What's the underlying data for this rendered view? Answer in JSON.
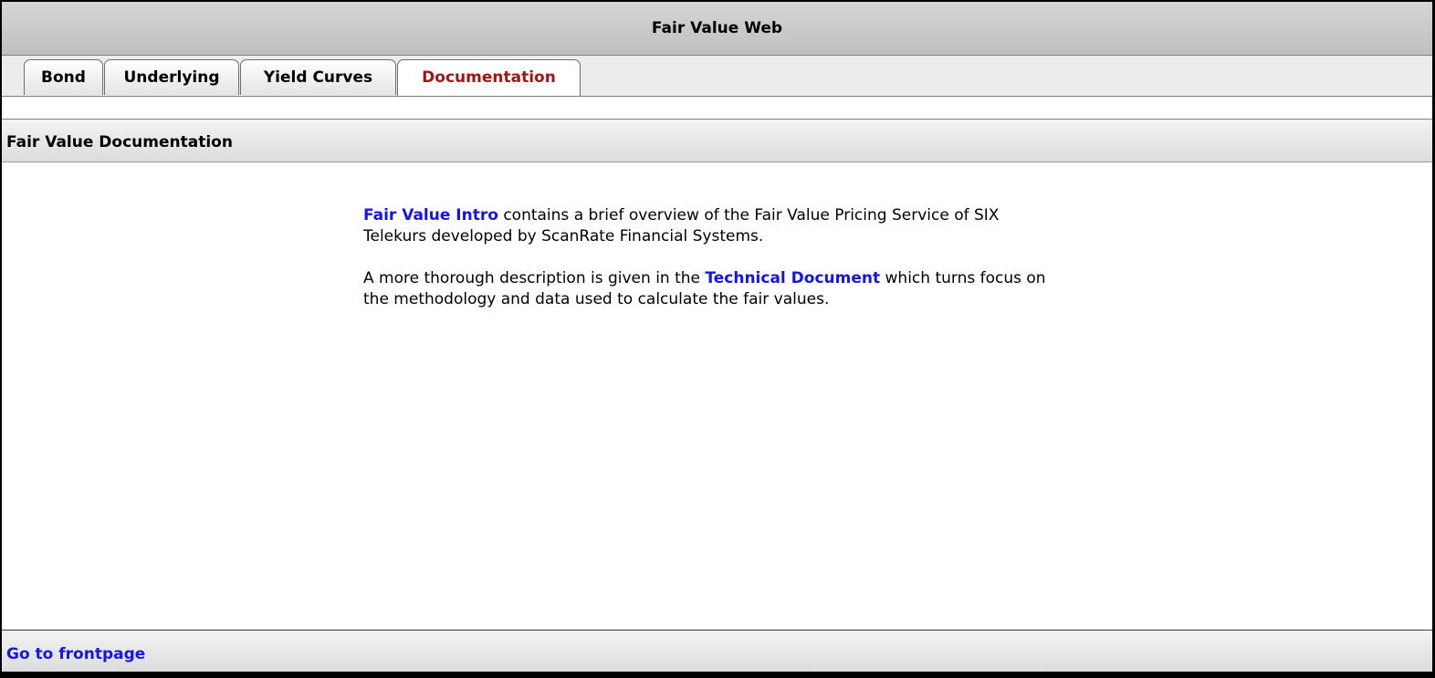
{
  "window": {
    "title": "Fair Value Web"
  },
  "tabs": [
    {
      "label": "Bond",
      "active": false
    },
    {
      "label": "Underlying",
      "active": false
    },
    {
      "label": "Yield Curves",
      "active": false
    },
    {
      "label": "Documentation",
      "active": true
    }
  ],
  "section": {
    "title": "Fair Value Documentation"
  },
  "documentation": {
    "intro_link": "Fair Value Intro",
    "intro_text": " contains a brief overview of the Fair Value Pricing Service of SIX Telekurs developed by ScanRate Financial Systems.",
    "tech_text_before": "A more thorough description is given in the ",
    "tech_link": "Technical Document",
    "tech_text_after": " which turns focus on the methodology and data used to calculate the fair values."
  },
  "footer": {
    "frontpage_link": "Go to frontpage"
  },
  "colors": {
    "link": "#1515e8",
    "active_tab": "#a31515",
    "header_bg": "#c8c8c8"
  }
}
